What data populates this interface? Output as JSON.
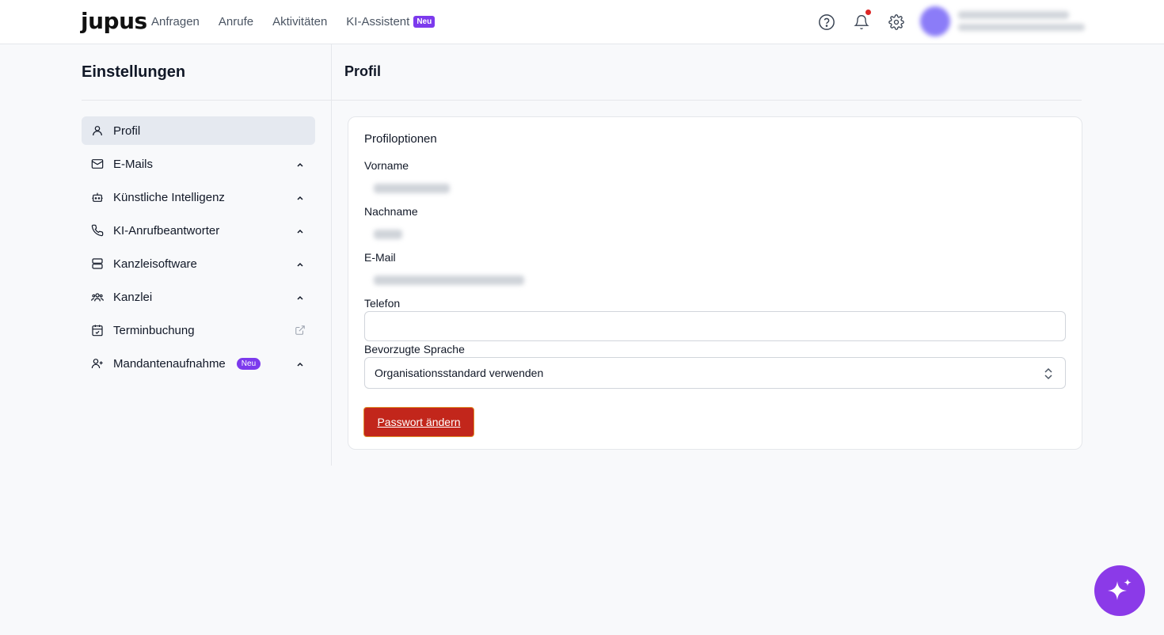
{
  "brand": {
    "logo_text": "jupus"
  },
  "nav": {
    "items": [
      {
        "label": "Anfragen"
      },
      {
        "label": "Anrufe"
      },
      {
        "label": "Aktivitäten"
      },
      {
        "label": "KI-Assistent",
        "badge": "Neu"
      }
    ]
  },
  "header_icons": [
    "help-circle-icon",
    "bell-icon",
    "gear-icon"
  ],
  "sidebar": {
    "title": "Einstellungen",
    "items": [
      {
        "label": "Profil",
        "icon": "user-icon",
        "active": true
      },
      {
        "label": "E-Mails",
        "icon": "mail-icon",
        "chevron": "up"
      },
      {
        "label": "Künstliche Intelligenz",
        "icon": "robot-icon",
        "chevron": "up"
      },
      {
        "label": "KI-Anrufbeantworter",
        "icon": "phone-icon",
        "chevron": "up"
      },
      {
        "label": "Kanzleisoftware",
        "icon": "server-icon",
        "chevron": "up"
      },
      {
        "label": "Kanzlei",
        "icon": "users-icon",
        "chevron": "up"
      },
      {
        "label": "Terminbuchung",
        "icon": "calendar-check-icon",
        "external": true
      },
      {
        "label": "Mandantenaufnahme",
        "icon": "user-plus-icon",
        "badge": "Neu",
        "chevron": "up"
      }
    ]
  },
  "main": {
    "title": "Profil",
    "card": {
      "title": "Profiloptionen",
      "fields": {
        "vorname": {
          "label": "Vorname"
        },
        "nachname": {
          "label": "Nachname"
        },
        "email": {
          "label": "E-Mail"
        },
        "telefon": {
          "label": "Telefon",
          "value": ""
        },
        "sprache": {
          "label": "Bevorzugte Sprache",
          "selected": "Organisationsstandard verwenden"
        }
      },
      "password_button": "Passwort ändern"
    }
  },
  "colors": {
    "accent_purple": "#7c3aed",
    "danger_button": "#c2261b",
    "fab": "#8b3ae8"
  }
}
